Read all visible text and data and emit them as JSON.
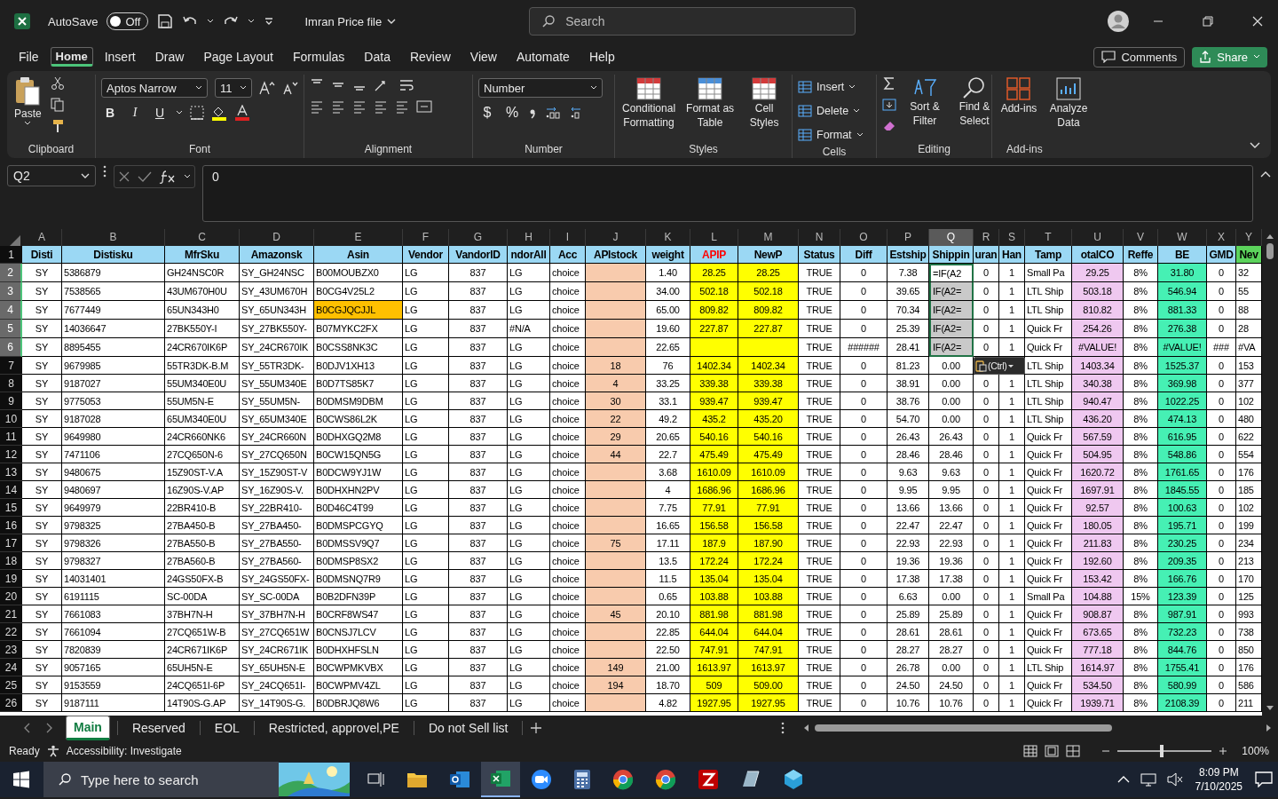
{
  "title_bar": {
    "autosave": {
      "label": "AutoSave",
      "state": "Off",
      "on": false
    },
    "file_name": "Imran Price file",
    "search": {
      "placeholder": "Search"
    }
  },
  "menu_tabs": [
    {
      "label": "File",
      "selected": false
    },
    {
      "label": "Home",
      "selected": true
    },
    {
      "label": "Insert",
      "selected": false
    },
    {
      "label": "Draw",
      "selected": false
    },
    {
      "label": "Page Layout",
      "selected": false
    },
    {
      "label": "Formulas",
      "selected": false
    },
    {
      "label": "Data",
      "selected": false
    },
    {
      "label": "Review",
      "selected": false
    },
    {
      "label": "View",
      "selected": false
    },
    {
      "label": "Automate",
      "selected": false
    },
    {
      "label": "Help",
      "selected": false
    }
  ],
  "menu_actions": {
    "comments": "Comments",
    "share": "Share"
  },
  "ribbon": {
    "clipboard": {
      "paste": "Paste",
      "label": "Clipboard"
    },
    "font": {
      "name": "Aptos Narrow",
      "size": "11",
      "buttons": [
        {
          "text": "B",
          "kind": "bold"
        },
        {
          "text": "I",
          "kind": "italic"
        },
        {
          "text": "U",
          "kind": "underline"
        }
      ],
      "label": "Font"
    },
    "alignment": {
      "label": "Alignment"
    },
    "number": {
      "format": "Number",
      "symbols": [
        "$",
        "%"
      ],
      "label": "Number"
    },
    "styles": {
      "buttons": [
        {
          "lines": [
            "Conditional",
            "Formatting"
          ]
        },
        {
          "lines": [
            "Format as",
            "Table"
          ]
        },
        {
          "lines": [
            "Cell",
            "Styles"
          ]
        }
      ],
      "label": "Styles"
    },
    "cells": {
      "buttons": [
        "Insert",
        "Delete",
        "Format"
      ],
      "label": "Cells"
    },
    "editing": {
      "buttons": [
        {
          "lines": [
            "Sort &",
            "Filter"
          ]
        },
        {
          "lines": [
            "Find &",
            "Select"
          ]
        }
      ],
      "label": "Editing"
    },
    "addins": {
      "buttons": [
        {
          "lines": [
            "Add-ins"
          ]
        },
        {
          "lines": [
            "Analyze",
            "Data"
          ]
        }
      ],
      "label": "Add-ins"
    }
  },
  "formula_bar": {
    "name_box": "Q2",
    "formula": "0"
  },
  "sheet": {
    "header_row_number": "1",
    "columns": [
      {
        "letter": "A",
        "header": {
          "text": "Disti",
          "kind": "plain"
        },
        "selected": false
      },
      {
        "letter": "B",
        "header": {
          "text": "Distisku",
          "kind": "plain"
        },
        "selected": false
      },
      {
        "letter": "C",
        "header": {
          "text": "MfrSku",
          "kind": "plain"
        },
        "selected": false
      },
      {
        "letter": "D",
        "header": {
          "text": "Amazonsk",
          "kind": "plain"
        },
        "selected": false
      },
      {
        "letter": "E",
        "header": {
          "text": "Asin",
          "kind": "plain"
        },
        "selected": false
      },
      {
        "letter": "F",
        "header": {
          "text": "Vendor",
          "kind": "plain"
        },
        "selected": false
      },
      {
        "letter": "G",
        "header": {
          "text": "VandorID",
          "kind": "plain"
        },
        "selected": false
      },
      {
        "letter": "H",
        "header": {
          "text": "ndorAll",
          "kind": "plain"
        },
        "selected": false
      },
      {
        "letter": "I",
        "header": {
          "text": "Acc",
          "kind": "plain"
        },
        "selected": false
      },
      {
        "letter": "J",
        "header": {
          "text": "APIstock",
          "kind": "plain"
        },
        "selected": false,
        "color": "#f8cbad"
      },
      {
        "letter": "K",
        "header": {
          "text": "weight",
          "kind": "plain"
        },
        "selected": false
      },
      {
        "letter": "L",
        "header": {
          "text": "APIP",
          "kind": "alert"
        },
        "selected": false,
        "color": "#ffff00"
      },
      {
        "letter": "M",
        "header": {
          "text": "NewP",
          "kind": "plain"
        },
        "selected": false,
        "color": "#ffff00"
      },
      {
        "letter": "N",
        "header": {
          "text": "Status",
          "kind": "plain"
        },
        "selected": false
      },
      {
        "letter": "O",
        "header": {
          "text": "Diff",
          "kind": "plain"
        },
        "selected": false
      },
      {
        "letter": "P",
        "header": {
          "text": "Estship",
          "kind": "plain"
        },
        "selected": false
      },
      {
        "letter": "Q",
        "header": {
          "text": "Shippin",
          "kind": "plain"
        },
        "selected": true
      },
      {
        "letter": "R",
        "header": {
          "text": "uran",
          "kind": "plain"
        },
        "selected": false
      },
      {
        "letter": "S",
        "header": {
          "text": "Han",
          "kind": "plain"
        },
        "selected": false
      },
      {
        "letter": "T",
        "header": {
          "text": "Tamp",
          "kind": "plain"
        },
        "selected": false
      },
      {
        "letter": "U",
        "header": {
          "text": "otalCO",
          "kind": "plain"
        },
        "selected": false,
        "color": "#efc8f0"
      },
      {
        "letter": "V",
        "header": {
          "text": "Reffe",
          "kind": "plain"
        },
        "selected": false
      },
      {
        "letter": "W",
        "header": {
          "text": "BE",
          "kind": "plain"
        },
        "selected": false,
        "color": "#46f0b4"
      },
      {
        "letter": "X",
        "header": {
          "text": "GMD",
          "kind": "plain"
        },
        "selected": false
      },
      {
        "letter": "Y",
        "header": {
          "text": "Nev",
          "kind": "plain",
          "color": "#5cd35c"
        },
        "selected": false
      }
    ],
    "rows": [
      {
        "number": "2",
        "selected": true,
        "cells": [
          "SY",
          "5386879",
          "GH24NSC0R",
          "SY_GH24NSC",
          "B00MOUBZX0",
          "LG",
          "837",
          "LG",
          "choice",
          null,
          "1.40",
          "28.25",
          "28.25",
          "TRUE",
          "0",
          "7.38",
          "=IF(A2",
          "0",
          "1",
          "Small Pa",
          "29.25",
          "8%",
          "31.80",
          "0",
          "32"
        ]
      },
      {
        "number": "3",
        "selected": true,
        "cells": [
          "SY",
          "7538565",
          "43UM670H0U",
          "SY_43UM670H",
          "B0CG4V25L2",
          "LG",
          "837",
          "LG",
          "choice",
          null,
          "34.00",
          "502.18",
          "502.18",
          "TRUE",
          "0",
          "39.65",
          "IF(A2=",
          "0",
          "1",
          "LTL Ship",
          "503.18",
          "8%",
          "546.94",
          "0",
          "55"
        ]
      },
      {
        "number": "4",
        "selected": true,
        "cells": [
          "SY",
          "7677449",
          "65UN343H0",
          "SY_65UN343H",
          {
            "text": "B0CGJQCJJL",
            "color": "#ffc000"
          },
          "LG",
          "837",
          "LG",
          "choice",
          null,
          "65.00",
          "809.82",
          "809.82",
          "TRUE",
          "0",
          "70.34",
          "IF(A2=",
          "0",
          "1",
          "LTL Ship",
          "810.82",
          "8%",
          "881.33",
          "0",
          "88"
        ]
      },
      {
        "number": "5",
        "selected": true,
        "cells": [
          "SY",
          "14036647",
          "27BK550Y-I",
          "SY_27BK550Y-",
          "B07MYKC2FX",
          "LG",
          "837",
          "#N/A",
          "choice",
          null,
          "19.60",
          "227.87",
          "227.87",
          "TRUE",
          "0",
          "25.39",
          "IF(A2=",
          "0",
          "1",
          "Quick Fr",
          "254.26",
          "8%",
          "276.38",
          "0",
          "28"
        ]
      },
      {
        "number": "6",
        "selected": true,
        "cells": [
          "SY",
          "8895455",
          "24CR670IK6P",
          "SY_24CR670IK",
          "B0CSS8NK3C",
          "LG",
          "837",
          "LG",
          "choice",
          null,
          "22.65",
          null,
          null,
          "TRUE",
          "######",
          "28.41",
          "IF(A2=",
          "0",
          "1",
          "Quick Fr",
          "#VALUE!",
          "8%",
          "#VALUE!",
          "###",
          "#VA"
        ]
      },
      {
        "number": "7",
        "selected": false,
        "cells": [
          "SY",
          "9679985",
          "55TR3DK-B.M",
          "SY_55TR3DK-",
          "B0DJV1XH13",
          "LG",
          "837",
          "LG",
          "choice",
          "18",
          "76",
          "1402.34",
          "1402.34",
          "TRUE",
          "0",
          "81.23",
          "0.00",
          null,
          null,
          "LTL Ship",
          "1403.34",
          "8%",
          "1525.37",
          "0",
          "153"
        ]
      },
      {
        "number": "8",
        "selected": false,
        "cells": [
          "SY",
          "9187027",
          "55UM340E0U",
          "SY_55UM340E",
          "B0D7TS85K7",
          "LG",
          "837",
          "LG",
          "choice",
          "4",
          "33.25",
          "339.38",
          "339.38",
          "TRUE",
          "0",
          "38.91",
          "0.00",
          "0",
          "1",
          "LTL Ship",
          "340.38",
          "8%",
          "369.98",
          "0",
          "377"
        ]
      },
      {
        "number": "9",
        "selected": false,
        "cells": [
          "SY",
          "9775053",
          "55UM5N-E",
          "SY_55UM5N-",
          "B0DMSM9DBM",
          "LG",
          "837",
          "LG",
          "choice",
          "30",
          "33.1",
          "939.47",
          "939.47",
          "TRUE",
          "0",
          "38.76",
          "0.00",
          "0",
          "1",
          "LTL Ship",
          "940.47",
          "8%",
          "1022.25",
          "0",
          "102"
        ]
      },
      {
        "number": "10",
        "selected": false,
        "cells": [
          "SY",
          "9187028",
          "65UM340E0U",
          "SY_65UM340E",
          "B0CWS86L2K",
          "LG",
          "837",
          "LG",
          "choice",
          "22",
          "49.2",
          "435.2",
          "435.20",
          "TRUE",
          "0",
          "54.70",
          "0.00",
          "0",
          "1",
          "LTL Ship",
          "436.20",
          "8%",
          "474.13",
          "0",
          "480"
        ]
      },
      {
        "number": "11",
        "selected": false,
        "cells": [
          "SY",
          "9649980",
          "24CR660NK6",
          "SY_24CR660N",
          "B0DHXGQ2M8",
          "LG",
          "837",
          "LG",
          "choice",
          "29",
          "20.65",
          "540.16",
          "540.16",
          "TRUE",
          "0",
          "26.43",
          "26.43",
          "0",
          "1",
          "Quick Fr",
          "567.59",
          "8%",
          "616.95",
          "0",
          "622"
        ]
      },
      {
        "number": "12",
        "selected": false,
        "cells": [
          "SY",
          "7471106",
          "27CQ650N-6",
          "SY_27CQ650N",
          "B0CW15QN5G",
          "LG",
          "837",
          "LG",
          "choice",
          "44",
          "22.7",
          "475.49",
          "475.49",
          "TRUE",
          "0",
          "28.46",
          "28.46",
          "0",
          "1",
          "Quick Fr",
          "504.95",
          "8%",
          "548.86",
          "0",
          "554"
        ]
      },
      {
        "number": "13",
        "selected": false,
        "cells": [
          "SY",
          "9480675",
          "15Z90ST-V.A",
          "SY_15Z90ST-V",
          "B0DCW9YJ1W",
          "LG",
          "837",
          "LG",
          "choice",
          null,
          "3.68",
          "1610.09",
          "1610.09",
          "TRUE",
          "0",
          "9.63",
          "9.63",
          "0",
          "1",
          "Quick Fr",
          "1620.72",
          "8%",
          "1761.65",
          "0",
          "176"
        ]
      },
      {
        "number": "14",
        "selected": false,
        "cells": [
          "SY",
          "9480697",
          "16Z90S-V.AP",
          "SY_16Z90S-V.",
          "B0DHXHN2PV",
          "LG",
          "837",
          "LG",
          "choice",
          null,
          "4",
          "1686.96",
          "1686.96",
          "TRUE",
          "0",
          "9.95",
          "9.95",
          "0",
          "1",
          "Quick Fr",
          "1697.91",
          "8%",
          "1845.55",
          "0",
          "185"
        ]
      },
      {
        "number": "15",
        "selected": false,
        "cells": [
          "SY",
          "9649979",
          "22BR410-B",
          "SY_22BR410-",
          "B0D46C4T99",
          "LG",
          "837",
          "LG",
          "choice",
          null,
          "7.75",
          "77.91",
          "77.91",
          "TRUE",
          "0",
          "13.66",
          "13.66",
          "0",
          "1",
          "Quick Fr",
          "92.57",
          "8%",
          "100.63",
          "0",
          "102"
        ]
      },
      {
        "number": "16",
        "selected": false,
        "cells": [
          "SY",
          "9798325",
          "27BA450-B",
          "SY_27BA450-",
          "B0DMSPCGYQ",
          "LG",
          "837",
          "LG",
          "choice",
          null,
          "16.65",
          "156.58",
          "156.58",
          "TRUE",
          "0",
          "22.47",
          "22.47",
          "0",
          "1",
          "Quick Fr",
          "180.05",
          "8%",
          "195.71",
          "0",
          "199"
        ]
      },
      {
        "number": "17",
        "selected": false,
        "cells": [
          "SY",
          "9798326",
          "27BA550-B",
          "SY_27BA550-",
          "B0DMSSV9Q7",
          "LG",
          "837",
          "LG",
          "choice",
          "75",
          "17.11",
          "187.9",
          "187.90",
          "TRUE",
          "0",
          "22.93",
          "22.93",
          "0",
          "1",
          "Quick Fr",
          "211.83",
          "8%",
          "230.25",
          "0",
          "234"
        ]
      },
      {
        "number": "18",
        "selected": false,
        "cells": [
          "SY",
          "9798327",
          "27BA560-B",
          "SY_27BA560-",
          "B0DMSP8SX2",
          "LG",
          "837",
          "LG",
          "choice",
          null,
          "13.5",
          "172.24",
          "172.24",
          "TRUE",
          "0",
          "19.36",
          "19.36",
          "0",
          "1",
          "Quick Fr",
          "192.60",
          "8%",
          "209.35",
          "0",
          "213"
        ]
      },
      {
        "number": "19",
        "selected": false,
        "cells": [
          "SY",
          "14031401",
          "24GS50FX-B",
          "SY_24GS50FX-",
          "B0DMSNQ7R9",
          "LG",
          "837",
          "LG",
          "choice",
          null,
          "11.5",
          "135.04",
          "135.04",
          "TRUE",
          "0",
          "17.38",
          "17.38",
          "0",
          "1",
          "Quick Fr",
          "153.42",
          "8%",
          "166.76",
          "0",
          "170"
        ]
      },
      {
        "number": "20",
        "selected": false,
        "cells": [
          "SY",
          "6191115",
          "SC-00DA",
          "SY_SC-00DA",
          "B0B2DFN39P",
          "LG",
          "837",
          "LG",
          "choice",
          null,
          "0.65",
          "103.88",
          "103.88",
          "TRUE",
          "0",
          "6.63",
          "0.00",
          "0",
          "1",
          "Small Pa",
          "104.88",
          "15%",
          "123.39",
          "0",
          "125"
        ]
      },
      {
        "number": "21",
        "selected": false,
        "cells": [
          "SY",
          "7661083",
          "37BH7N-H",
          "SY_37BH7N-H",
          "B0CRF8WS47",
          "LG",
          "837",
          "LG",
          "choice",
          "45",
          "20.10",
          "881.98",
          "881.98",
          "TRUE",
          "0",
          "25.89",
          "25.89",
          "0",
          "1",
          "Quick Fr",
          "908.87",
          "8%",
          "987.91",
          "0",
          "993"
        ]
      },
      {
        "number": "22",
        "selected": false,
        "cells": [
          "SY",
          "7661094",
          "27CQ651W-B",
          "SY_27CQ651W",
          "B0CNSJ7LCV",
          "LG",
          "837",
          "LG",
          "choice",
          null,
          "22.85",
          "644.04",
          "644.04",
          "TRUE",
          "0",
          "28.61",
          "28.61",
          "0",
          "1",
          "Quick Fr",
          "673.65",
          "8%",
          "732.23",
          "0",
          "738"
        ]
      },
      {
        "number": "23",
        "selected": false,
        "cells": [
          "SY",
          "7820839",
          "24CR671IK6P",
          "SY_24CR671IK",
          "B0DHXHFSLN",
          "LG",
          "837",
          "LG",
          "choice",
          null,
          "22.50",
          "747.91",
          "747.91",
          "TRUE",
          "0",
          "28.27",
          "28.27",
          "0",
          "1",
          "Quick Fr",
          "777.18",
          "8%",
          "844.76",
          "0",
          "850"
        ]
      },
      {
        "number": "24",
        "selected": false,
        "cells": [
          "SY",
          "9057165",
          "65UH5N-E",
          "SY_65UH5N-E",
          "B0CWPMKVBX",
          "LG",
          "837",
          "LG",
          "choice",
          "149",
          "21.00",
          "1613.97",
          "1613.97",
          "TRUE",
          "0",
          "26.78",
          "0.00",
          "0",
          "1",
          "LTL Ship",
          "1614.97",
          "8%",
          "1755.41",
          "0",
          "176"
        ]
      },
      {
        "number": "25",
        "selected": false,
        "cells": [
          "SY",
          "9153559",
          "24CQ651I-6P",
          "SY_24CQ651I-",
          "B0CWPMV4ZL",
          "LG",
          "837",
          "LG",
          "choice",
          "194",
          "18.70",
          "509",
          "509.00",
          "TRUE",
          "0",
          "24.50",
          "24.50",
          "0",
          "1",
          "Quick Fr",
          "534.50",
          "8%",
          "580.99",
          "0",
          "586"
        ]
      },
      {
        "number": "26",
        "selected": false,
        "cells": [
          "SY",
          "9187111",
          "14T90S-G.AP",
          "SY_14T90S-G.",
          "B0DBRJQ8W6",
          "LG",
          "837",
          "LG",
          "choice",
          null,
          "4.82",
          "1927.95",
          "1927.95",
          "TRUE",
          "0",
          "10.76",
          "10.76",
          "0",
          "1",
          "Quick Fr",
          "1939.71",
          "8%",
          "2108.39",
          "0",
          "211"
        ]
      }
    ],
    "paste_options": "(Ctrl)"
  },
  "sheet_tabs": [
    {
      "label": "Main",
      "selected": true
    },
    {
      "label": "Reserved",
      "selected": false
    },
    {
      "label": "EOL",
      "selected": false
    },
    {
      "label": "Restricted, approvel,PE",
      "selected": false
    },
    {
      "label": "Do not Sell list",
      "selected": false
    }
  ],
  "status_bar": {
    "mode": "Ready",
    "accessibility": "Accessibility: Investigate",
    "zoom": {
      "level": 0.47,
      "reading": "100%"
    }
  },
  "taskbar": {
    "search": {
      "placeholder": "Type here to search"
    },
    "time": "8:09 PM",
    "date": "7/10/2025"
  }
}
